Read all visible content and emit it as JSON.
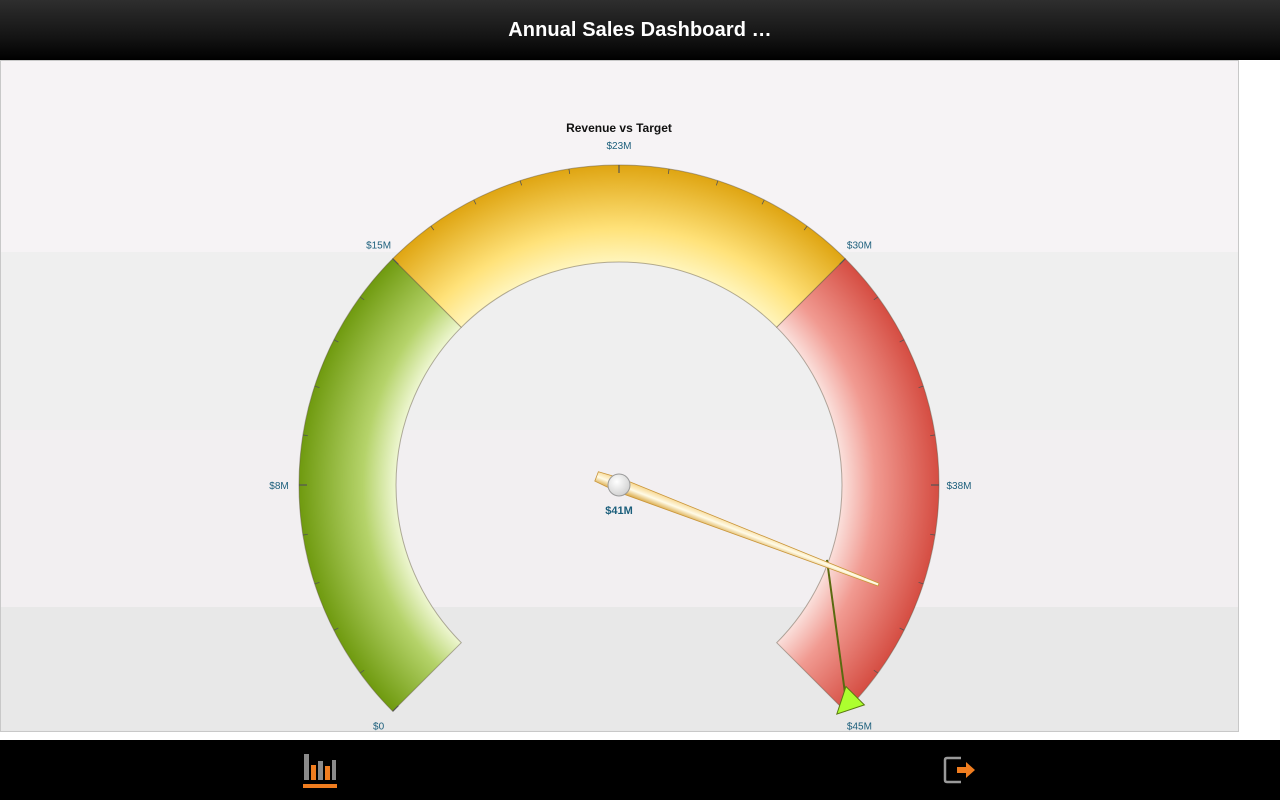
{
  "header": {
    "title": "Annual Sales Dashboard …"
  },
  "chart_data": {
    "type": "gauge",
    "title": "Revenue vs Target",
    "min": 0,
    "max": 45,
    "unit": "M",
    "value": 41,
    "value_label": "$41M",
    "target": 45,
    "tick_labels": [
      "$0",
      "$8M",
      "$15M",
      "$23M",
      "$30M",
      "$38M",
      "$45M"
    ],
    "tick_values": [
      0,
      7.5,
      15,
      22.5,
      30,
      37.5,
      45
    ],
    "ranges": [
      {
        "from": 0,
        "to": 15,
        "color": "#7ea51a"
      },
      {
        "from": 15,
        "to": 30,
        "color": "#e8b11a"
      },
      {
        "from": 30,
        "to": 45,
        "color": "#de5a4f"
      }
    ],
    "target_marker_color": "#adff2f",
    "label_color": "#1c5f7c"
  },
  "bottom_nav": {
    "items": [
      {
        "icon": "bar-chart-icon",
        "active": true,
        "accent": "#f07d1f"
      },
      {
        "icon": "exit-icon",
        "active": false,
        "accent": "#f07d1f"
      }
    ]
  }
}
